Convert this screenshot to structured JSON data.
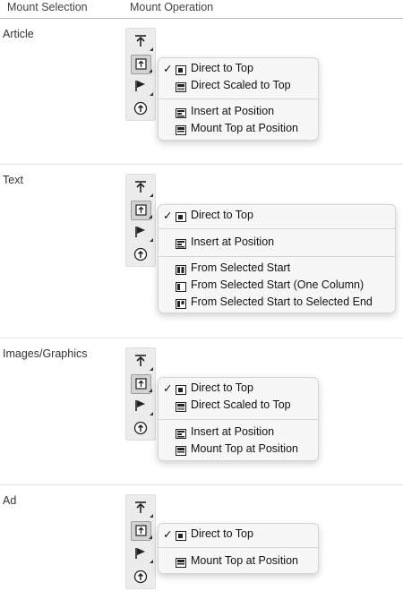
{
  "header": {
    "col_selection": "Mount Selection",
    "col_operation": "Mount Operation"
  },
  "sections": [
    {
      "label": "Article",
      "menu_items": [
        {
          "check": "✓",
          "icon": "mount-direct-icon",
          "label": "Direct to Top"
        },
        {
          "check": "",
          "icon": "mount-scaled-icon",
          "label": "Direct Scaled to Top"
        },
        {
          "check": "",
          "icon": "insert-position-icon",
          "label": "Insert at Position"
        },
        {
          "check": "",
          "icon": "mount-top-position-icon",
          "label": "Mount Top at Position"
        }
      ]
    },
    {
      "label": "Text",
      "menu_items": [
        {
          "check": "✓",
          "icon": "mount-direct-icon",
          "label": "Direct to Top"
        },
        {
          "check": "",
          "icon": "insert-position-icon",
          "label": "Insert at Position"
        },
        {
          "check": "",
          "icon": "from-selected-start-icon",
          "label": "From Selected Start"
        },
        {
          "check": "",
          "icon": "from-selected-start-one-column-icon",
          "label": "From Selected Start (One Column)"
        },
        {
          "check": "",
          "icon": "from-selected-start-to-end-icon",
          "label": "From Selected Start to Selected End"
        }
      ]
    },
    {
      "label": "Images/Graphics",
      "menu_items": [
        {
          "check": "✓",
          "icon": "mount-direct-icon",
          "label": "Direct to Top"
        },
        {
          "check": "",
          "icon": "mount-scaled-icon",
          "label": "Direct Scaled to Top"
        },
        {
          "check": "",
          "icon": "insert-position-icon",
          "label": "Insert at Position"
        },
        {
          "check": "",
          "icon": "mount-top-position-icon",
          "label": "Mount Top at Position"
        }
      ]
    },
    {
      "label": "Ad",
      "menu_items": [
        {
          "check": "✓",
          "icon": "mount-direct-icon",
          "label": "Direct to Top"
        },
        {
          "check": "",
          "icon": "mount-top-position-icon",
          "label": "Mount Top at Position"
        }
      ]
    }
  ],
  "toolbar_icons": [
    "mount-to-top-icon",
    "mount-direct-icon",
    "flag-icon",
    "mount-circle-icon"
  ],
  "colors": {
    "toolbar_bg": "#ececec",
    "menu_bg": "#f7f7f7",
    "selected_tool_bg": "#d2d2d2"
  }
}
